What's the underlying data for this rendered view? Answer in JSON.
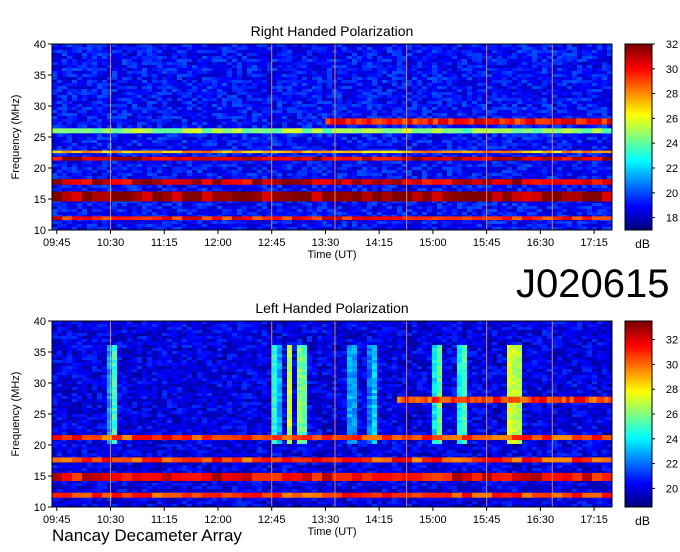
{
  "figure": {
    "id_label": "J020615",
    "credit": "Nancay Decameter Array"
  },
  "chart_data": [
    {
      "type": "heatmap",
      "title": "Right Handed Polarization",
      "xlabel": "Time (UT)",
      "ylabel": "Frequency (MHz)",
      "x_ticks": [
        "09:45",
        "10:30",
        "11:15",
        "12:00",
        "12:45",
        "13:30",
        "14:15",
        "15:00",
        "15:45",
        "16:30",
        "17:15"
      ],
      "y_ticks": [
        10,
        15,
        20,
        25,
        30,
        35,
        40
      ],
      "ylim": [
        10,
        40
      ],
      "colorbar": {
        "label": "dB",
        "ticks": [
          18,
          20,
          22,
          24,
          26,
          28,
          30,
          32
        ],
        "range": [
          17,
          32
        ]
      },
      "background_level_db": 19,
      "bands": [
        {
          "freq_from": 11.6,
          "freq_to": 12.2,
          "db": 30
        },
        {
          "freq_from": 14.6,
          "freq_to": 16.2,
          "db": 32
        },
        {
          "freq_from": 17.3,
          "freq_to": 18.2,
          "db": 31
        },
        {
          "freq_from": 21.2,
          "freq_to": 21.8,
          "db": 31
        },
        {
          "freq_from": 22.4,
          "freq_to": 22.8,
          "db": 28
        },
        {
          "freq_from": 27.0,
          "freq_to": 28.0,
          "db": 30,
          "time_from": "13:30",
          "time_to": "17:30"
        },
        {
          "freq_from": 25.6,
          "freq_to": 26.4,
          "db": 25
        }
      ],
      "vertical_lines": [
        "10:30",
        "12:45",
        "13:38",
        "14:38",
        "15:45",
        "16:40"
      ]
    },
    {
      "type": "heatmap",
      "title": "Left Handed Polarization",
      "xlabel": "Time (UT)",
      "ylabel": "Frequency (MHz)",
      "x_ticks": [
        "09:45",
        "10:30",
        "11:15",
        "12:00",
        "12:45",
        "13:30",
        "14:15",
        "15:00",
        "15:45",
        "16:30",
        "17:15"
      ],
      "y_ticks": [
        10,
        15,
        20,
        25,
        30,
        35,
        40
      ],
      "ylim": [
        10,
        40
      ],
      "colorbar": {
        "label": "dB",
        "ticks": [
          20,
          22,
          24,
          26,
          28,
          30,
          32
        ],
        "range": [
          18.5,
          33.5
        ]
      },
      "background_level_db": 20,
      "bands": [
        {
          "freq_from": 11.5,
          "freq_to": 12.3,
          "db": 31
        },
        {
          "freq_from": 14.2,
          "freq_to": 15.5,
          "db": 32
        },
        {
          "freq_from": 17.2,
          "freq_to": 18.0,
          "db": 31
        },
        {
          "freq_from": 20.8,
          "freq_to": 21.6,
          "db": 31
        },
        {
          "freq_from": 26.8,
          "freq_to": 27.8,
          "db": 31,
          "time_from": "14:30",
          "time_to": "17:30"
        }
      ],
      "bursts": [
        {
          "time": "10:33",
          "db": 25
        },
        {
          "time": "12:48",
          "db": 25
        },
        {
          "time": "13:00",
          "db": 27
        },
        {
          "time": "13:10",
          "db": 27
        },
        {
          "time": "13:52",
          "db": 24
        },
        {
          "time": "14:10",
          "db": 24
        },
        {
          "time": "15:05",
          "db": 26
        },
        {
          "time": "15:25",
          "db": 26
        },
        {
          "time": "16:05",
          "db": 28
        },
        {
          "time": "16:10",
          "db": 28
        }
      ],
      "vertical_lines": [
        "10:30",
        "12:45",
        "13:38",
        "14:38",
        "15:45",
        "16:40"
      ]
    }
  ]
}
